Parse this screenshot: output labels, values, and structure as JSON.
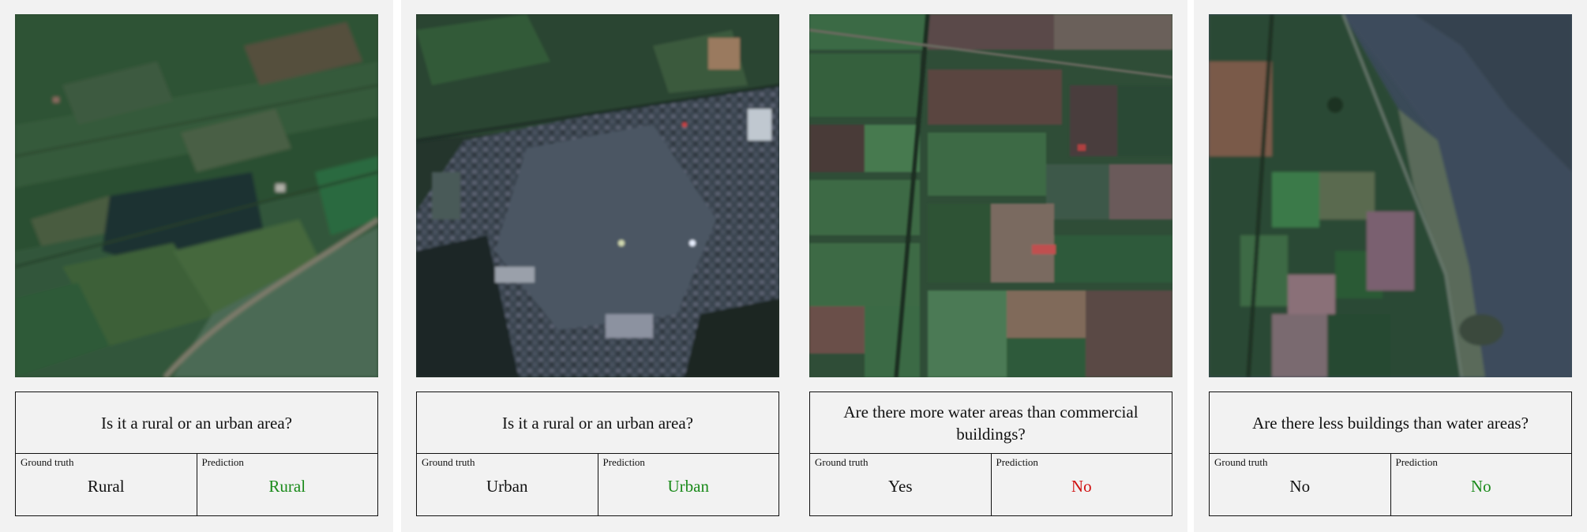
{
  "panels": [
    {
      "question": "Is it a rural or an urban area?",
      "ground_truth_label": "Ground truth",
      "prediction_label": "Prediction",
      "ground_truth": "Rural",
      "prediction": "Rural",
      "prediction_correct": true,
      "image": "rural farmland with lake"
    },
    {
      "question": "Is it a rural or an urban area?",
      "ground_truth_label": "Ground truth",
      "prediction_label": "Prediction",
      "ground_truth": "Urban",
      "prediction": "Urban",
      "prediction_correct": true,
      "image": "dense urban town"
    },
    {
      "question": "Are there more water areas than commercial buildings?",
      "ground_truth_label": "Ground truth",
      "prediction_label": "Prediction",
      "ground_truth": "Yes",
      "prediction": "No",
      "prediction_correct": false,
      "image": "agricultural field grid"
    },
    {
      "question": "Are there less buildings than water areas?",
      "ground_truth_label": "Ground truth",
      "prediction_label": "Prediction",
      "ground_truth": "No",
      "prediction": "No",
      "prediction_correct": true,
      "image": "fields along coastline with water"
    }
  ],
  "colors": {
    "correct": "#1a8a1a",
    "wrong": "#d01010",
    "neutral": "#111111"
  }
}
